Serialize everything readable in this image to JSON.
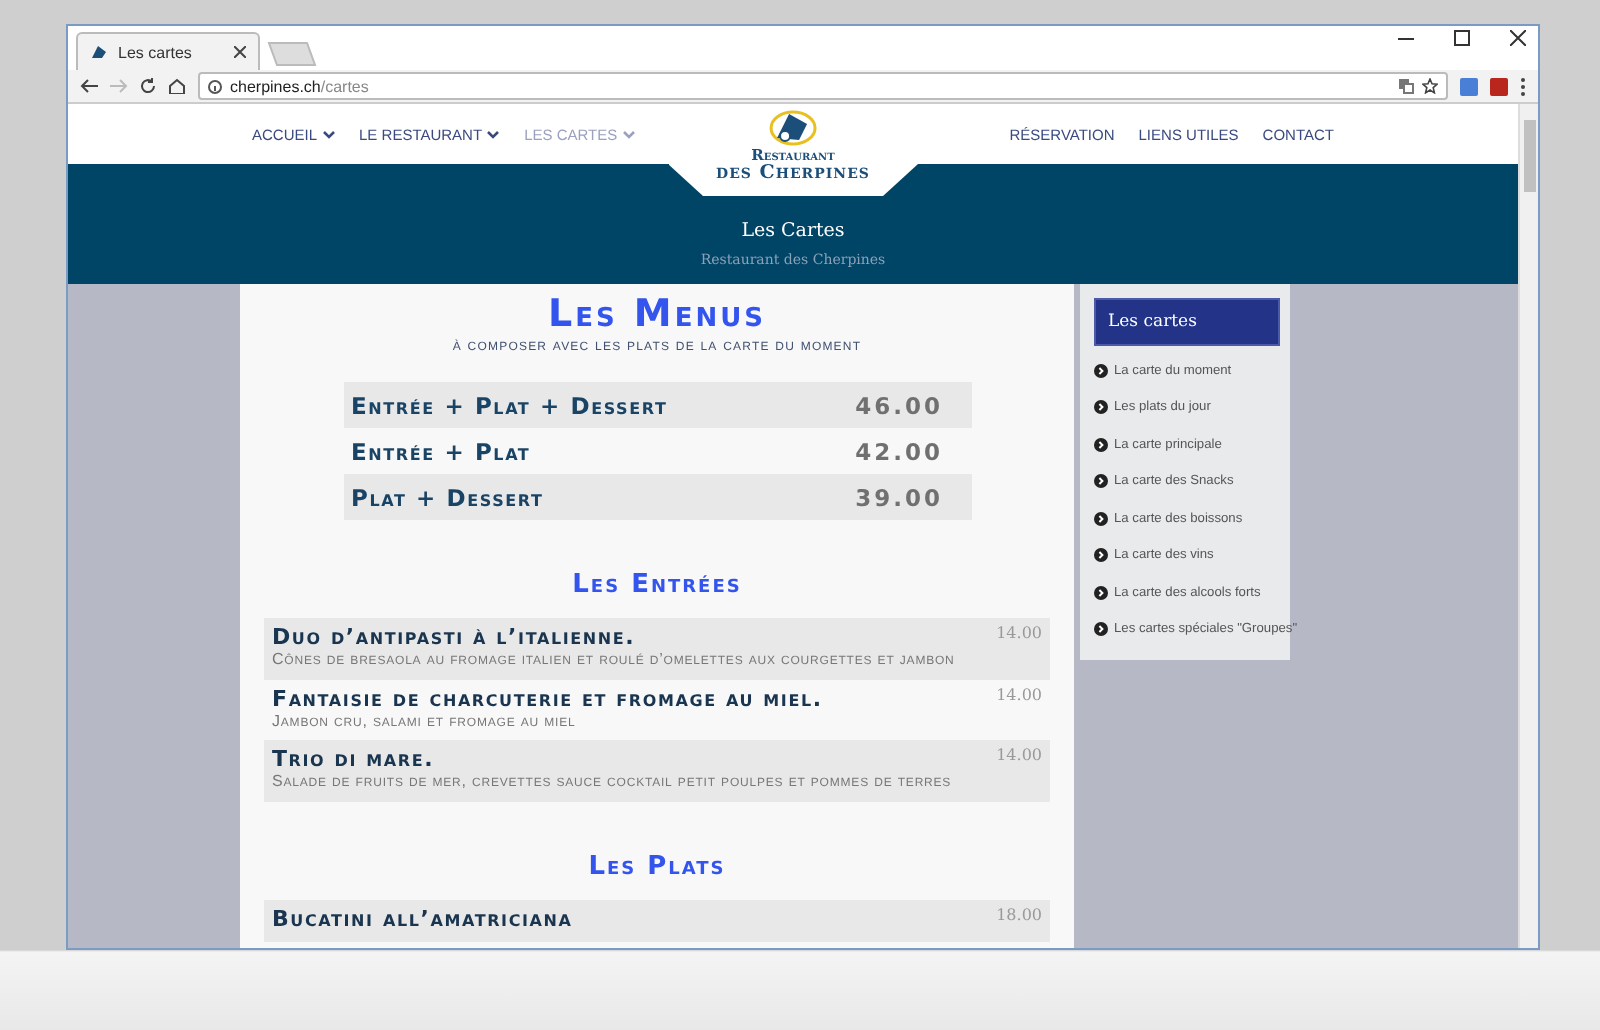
{
  "browser": {
    "tab_title": "Les cartes",
    "url": {
      "host": "cherpines.ch",
      "path": "/cartes"
    }
  },
  "nav": {
    "left": [
      {
        "label": "ACCUEIL",
        "selected": false
      },
      {
        "label": "LE RESTAURANT",
        "selected": false
      },
      {
        "label": "LES CARTES",
        "selected": true
      }
    ],
    "right": [
      {
        "label": "RÉSERVATION"
      },
      {
        "label": "LIENS UTILES"
      },
      {
        "label": "CONTACT"
      }
    ],
    "logo": {
      "line_1": "Restaurant",
      "line_2": "des Cherpines"
    }
  },
  "banner": {
    "title": "Les Cartes",
    "subtitle": "Restaurant des Cherpines"
  },
  "menus": {
    "title": "Les Menus",
    "subtitle": "à composer avec les plats de la carte du moment",
    "rows": [
      {
        "name": "Entrée + Plat + Dessert",
        "price": "46.00"
      },
      {
        "name": "Entrée + Plat",
        "price": "42.00"
      },
      {
        "name": "Plat + Dessert",
        "price": "39.00"
      }
    ]
  },
  "sections": [
    {
      "title": "Les Entrées",
      "items": [
        {
          "name": "Duo d’antipasti à l’italienne.",
          "description": "Cônes de bresaola au fromage italien et roulé d’omelettes aux courgettes et jambon",
          "price": "14.00"
        },
        {
          "name": "Fantaisie de charcuterie et fromage au miel.",
          "description": "Jambon cru, salami et fromage au miel",
          "price": "14.00"
        },
        {
          "name": "Trio di mare.",
          "description": "Salade de fruits de mer, crevettes sauce cocktail petit poulpes et pommes de terres",
          "price": "14.00"
        }
      ]
    },
    {
      "title": "Les Plats",
      "items": [
        {
          "name": "Bucatini all’amatriciana",
          "price": "18.00"
        }
      ]
    }
  ],
  "sidebar": {
    "title": "Les cartes",
    "items": [
      "La carte du moment",
      "Les plats du jour",
      "La carte principale",
      "La carte des Snacks",
      "La carte des boissons",
      "La carte des vins",
      "La carte des alcools forts",
      "Les cartes spéciales \"Groupes\""
    ]
  }
}
